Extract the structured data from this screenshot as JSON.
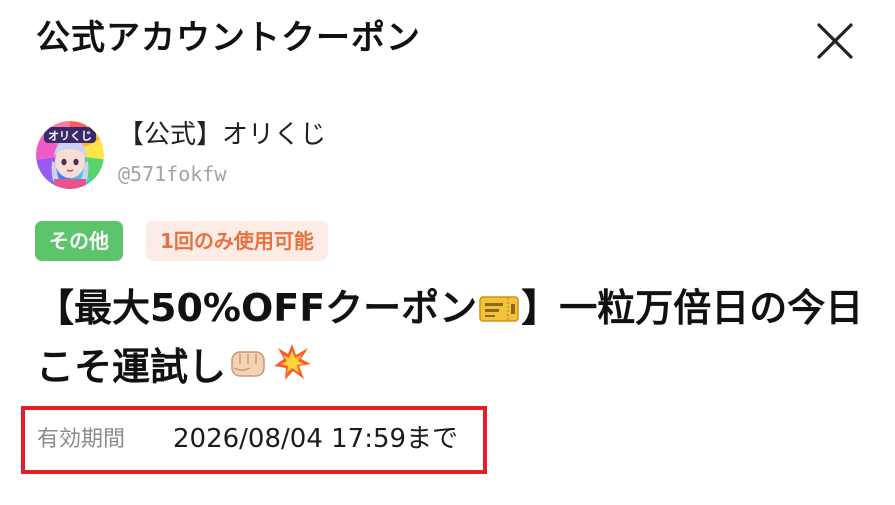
{
  "header": {
    "title": "公式アカウントクーポン",
    "close_icon": "close-icon"
  },
  "account": {
    "name": "【公式】オリくじ",
    "id": "@571fokfw",
    "avatar_icon": "avatar-icon",
    "avatar_logo_text": "オリくじ"
  },
  "tags": [
    {
      "label": "その他",
      "bg": "#5cc46b",
      "fg": "#ffffff"
    },
    {
      "label": "1回のみ使用可能",
      "bg": "#fdece6",
      "fg": "#e6733f"
    }
  ],
  "coupon": {
    "title_part1": "【最大50%OFFクーポン",
    "title_emoji1": "ticket-icon",
    "title_part2": "】一粒万倍日の今日こそ運試し",
    "title_emoji2": "fist-icon",
    "title_emoji3": "collision-icon"
  },
  "validity": {
    "label": "有効期間",
    "value": "2026/08/04  17:59まで",
    "highlight_color": "#e21f26"
  }
}
